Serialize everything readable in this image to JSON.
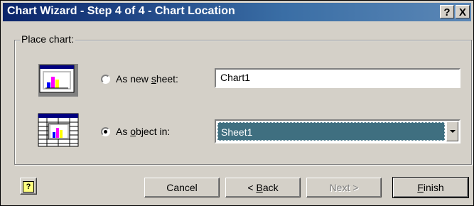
{
  "window": {
    "title": "Chart Wizard - Step 4 of 4 - Chart Location",
    "help_button": "?",
    "close_button": "X"
  },
  "group": {
    "label": "Place chart:"
  },
  "options": {
    "new_sheet": {
      "label_pre": "As new ",
      "label_key": "s",
      "label_post": "heet:",
      "value": "Chart1",
      "selected": false
    },
    "as_object": {
      "label_pre": "As ",
      "label_key": "o",
      "label_post": "bject in:",
      "value": "Sheet1",
      "selected": true
    }
  },
  "buttons": {
    "help": "?",
    "cancel": "Cancel",
    "back_pre": "< ",
    "back_key": "B",
    "back_post": "ack",
    "next": "Next >",
    "finish_key": "F",
    "finish_post": "inish"
  },
  "colors": {
    "titlebar": "#0a246a",
    "selection": "#3f6f80",
    "face": "#d4d0c8"
  }
}
